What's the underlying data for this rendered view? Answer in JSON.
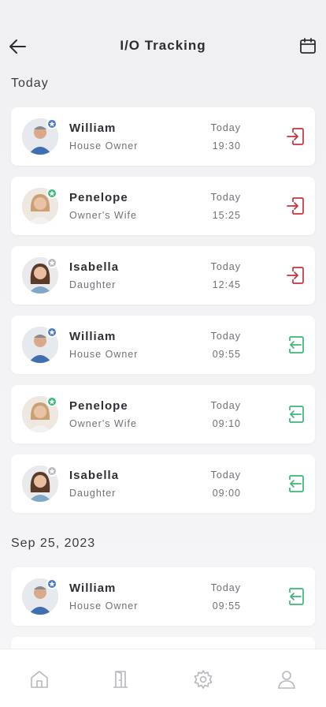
{
  "header": {
    "title": "I/O Tracking"
  },
  "colors": {
    "exit": "#c8323c",
    "enter": "#3cb878",
    "owner_badge": "#4a78c8",
    "wife_badge": "#3cb878",
    "daughter_badge": "#b8b8c0"
  },
  "sections": [
    {
      "label": "Today",
      "entries": [
        {
          "name": "William",
          "role": "House Owner",
          "day": "Today",
          "time": "19:30",
          "direction": "exit",
          "person": "william"
        },
        {
          "name": "Penelope",
          "role": "Owner's Wife",
          "day": "Today",
          "time": "15:25",
          "direction": "exit",
          "person": "penelope"
        },
        {
          "name": "Isabella",
          "role": "Daughter",
          "day": "Today",
          "time": "12:45",
          "direction": "exit",
          "person": "isabella"
        },
        {
          "name": "William",
          "role": "House Owner",
          "day": "Today",
          "time": "09:55",
          "direction": "enter",
          "person": "william"
        },
        {
          "name": "Penelope",
          "role": "Owner's Wife",
          "day": "Today",
          "time": "09:10",
          "direction": "enter",
          "person": "penelope"
        },
        {
          "name": "Isabella",
          "role": "Daughter",
          "day": "Today",
          "time": "09:00",
          "direction": "enter",
          "person": "isabella"
        }
      ]
    },
    {
      "label": "Sep 25, 2023",
      "entries": [
        {
          "name": "William",
          "role": "House Owner",
          "day": "Today",
          "time": "09:55",
          "direction": "enter",
          "person": "william"
        }
      ]
    }
  ],
  "tabbar": {
    "icons": [
      "home-icon",
      "door-icon",
      "settings-icon",
      "profile-icon"
    ]
  }
}
